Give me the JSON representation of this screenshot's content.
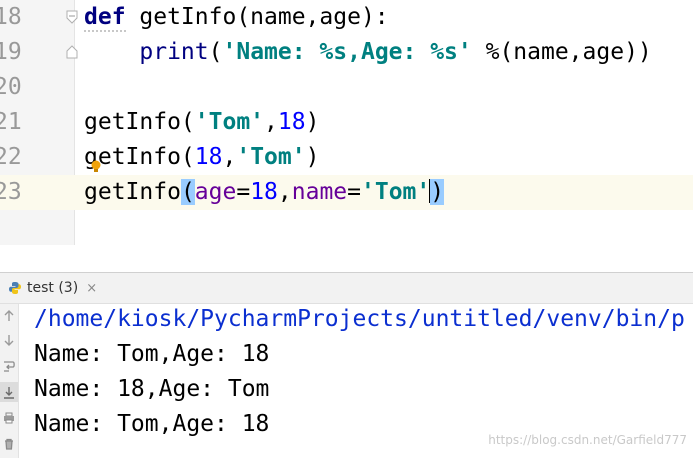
{
  "editor": {
    "lines": [
      {
        "num": "18"
      },
      {
        "num": "19"
      },
      {
        "num": "20"
      },
      {
        "num": "21"
      },
      {
        "num": "22"
      },
      {
        "num": "23"
      }
    ],
    "tokens": {
      "l18_def": "def",
      "l18_rest": " getInfo(name,age):",
      "l19_indent": "    ",
      "l19_print": "print",
      "l19_open": "(",
      "l19_str1": "'Name: %s,Age: %s'",
      "l19_rest": " %(name,age))",
      "l21_call": "getInfo(",
      "l21_str": "'Tom'",
      "l21_comma": ",",
      "l21_num": "18",
      "l21_close": ")",
      "l22_call": "getInfo(",
      "l22_num": "18",
      "l22_comma": ",",
      "l22_str": "'Tom'",
      "l22_close": ")",
      "l23_call": "getInfo",
      "l23_open": "(",
      "l23_kw1": "age",
      "l23_eq1": "=",
      "l23_num": "18",
      "l23_comma": ",",
      "l23_kw2": "name",
      "l23_eq2": "=",
      "l23_str": "'Tom'",
      "l23_close": ")"
    }
  },
  "run_panel": {
    "tab_label": "test",
    "tab_count": "(3)",
    "close_symbol": "×",
    "output": [
      "/home/kiosk/PycharmProjects/untitled/venv/bin/p",
      "Name: Tom,Age: 18",
      "Name: 18,Age: Tom",
      "Name: Tom,Age: 18"
    ]
  },
  "watermark": "https://blog.csdn.net/Garfield777",
  "colors": {
    "keyword": "#000080",
    "string": "#008080",
    "number": "#0000ff",
    "kwarg": "#660099",
    "current_line": "#fcfaed",
    "brace_match": "#99ccff",
    "command_path": "#0b2fd0"
  }
}
